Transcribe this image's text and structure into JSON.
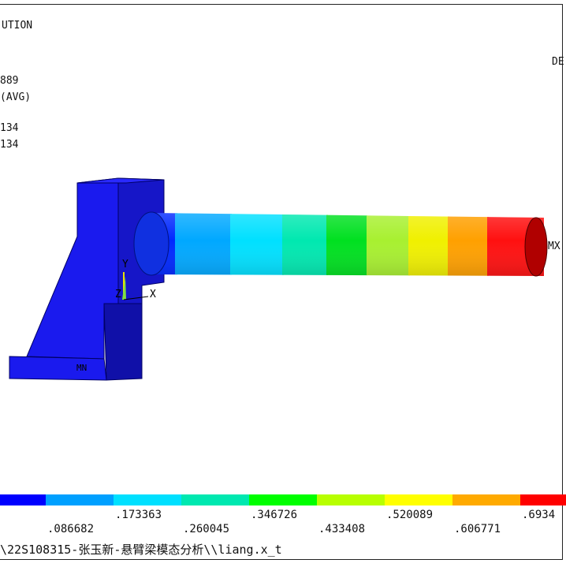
{
  "header": {
    "title_fragment": "UTION",
    "right_fragment": "DE",
    "lines": [
      "889",
      "(AVG)",
      "134",
      "134"
    ]
  },
  "model": {
    "max_label": "MX",
    "min_label": "MN",
    "axis_y": "Y",
    "axis_z": "Z",
    "axis_x": "X"
  },
  "legend": {
    "colors": [
      "#0000ff",
      "#00a0ff",
      "#00e0ff",
      "#00e8b0",
      "#00ff00",
      "#b8ff00",
      "#ffff00",
      "#ffaa00",
      "#ff0000"
    ],
    "upper_ticks": [
      ".173363",
      ".346726",
      ".520089",
      ".6934"
    ],
    "lower_ticks": [
      ".086682",
      ".260045",
      ".433408",
      ".606771"
    ]
  },
  "footer": {
    "path": "\\22S108315-张玉新-悬臂梁模态分析\\\\liang.x_t"
  }
}
